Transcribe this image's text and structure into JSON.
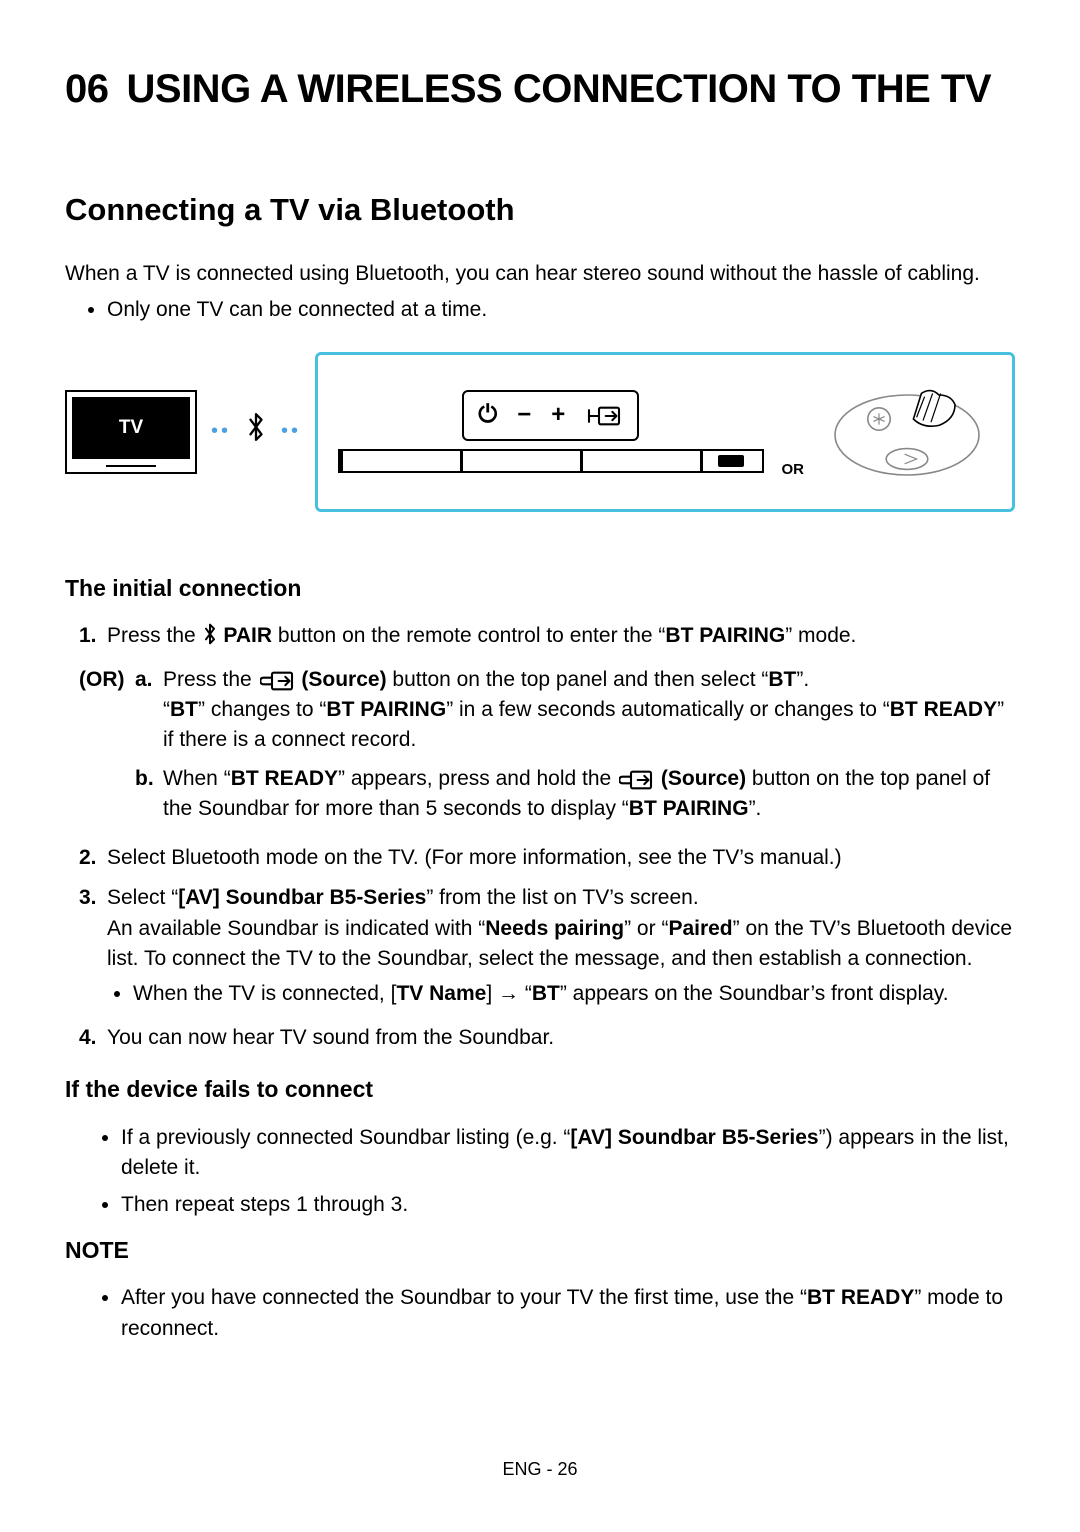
{
  "chapter": {
    "number": "06",
    "title": "USING A WIRELESS CONNECTION TO THE TV"
  },
  "section": {
    "title": "Connecting a TV via Bluetooth"
  },
  "lead": "When a TV is connected using Bluetooth, you can hear stereo sound without the hassle of cabling.",
  "lead_bullets": [
    "Only one TV can be connected at a time."
  ],
  "diagram": {
    "tv_label": "TV",
    "or_label": "OR"
  },
  "initial": {
    "heading": "The initial connection",
    "step1": {
      "num": "1.",
      "pre": "Press the ",
      "pair": "PAIR",
      "post": " button on the remote control to enter the “",
      "bt_pairing": "BT PAIRING",
      "post2": "” mode."
    },
    "or_label": "(OR)",
    "a": {
      "mk": "a.",
      "t1": "Press the ",
      "src": "(Source)",
      "t2": " button on the top panel and then select “",
      "bt": "BT",
      "t3": "”.",
      "line2_a": "“",
      "line2_b": "” changes to “",
      "line2_c": "” in a few seconds automatically or changes to “",
      "bt_ready": "BT READY",
      "line2_d": "” if there is a connect record."
    },
    "b": {
      "mk": "b.",
      "t1": "When “",
      "t2": "” appears, press and hold the ",
      "t3": " button on the top panel of the Soundbar for more than 5 seconds to display “",
      "t4": "”."
    },
    "step2": {
      "num": "2.",
      "text": "Select Bluetooth mode on the TV. (For more information, see the TV’s manual.)"
    },
    "step3": {
      "num": "3.",
      "t1": "Select “",
      "device": "[AV] Soundbar B5-Series",
      "t2": "” from the list on TV’s screen.",
      "t3": "An available Soundbar is indicated with “",
      "needs": "Needs pairing",
      "t4": "” or “",
      "paired": "Paired",
      "t5": "” on the TV’s Bluetooth device list. To connect the TV to the Soundbar, select the message, and then establish a connection.",
      "sub_t1": "When the TV is connected, [",
      "tvname": "TV Name",
      "sub_t2": "] → “",
      "sub_t3": "” appears on the Soundbar’s front display."
    },
    "step4": {
      "num": "4.",
      "text": "You can now hear TV sound from the Soundbar."
    }
  },
  "fail": {
    "heading": "If the device fails to connect",
    "b1a": "If a previously connected Soundbar listing (e.g. “",
    "device": "[AV] Soundbar B5-Series",
    "b1b": "”) appears in the list, delete it.",
    "b2": "Then repeat steps 1 through 3."
  },
  "note": {
    "heading": "NOTE",
    "t1": "After you have connected the Soundbar to your TV the first time, use the “",
    "bt_ready": "BT READY",
    "t2": "” mode to reconnect."
  },
  "footer": "ENG - 26"
}
